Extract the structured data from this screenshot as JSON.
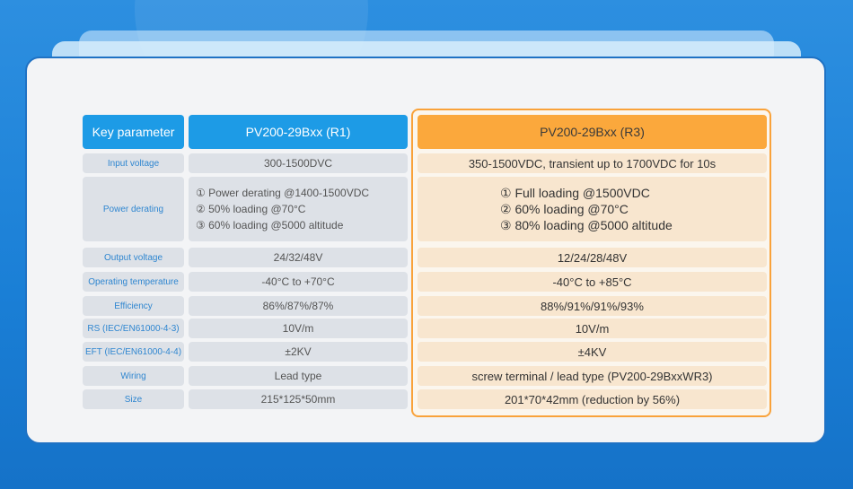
{
  "table": {
    "header": {
      "key": "Key parameter",
      "r1": "PV200-29Bxx (R1)",
      "r3": "PV200-29Bxx (R3)"
    },
    "rows": [
      {
        "label": "Input voltage",
        "r1": "300-1500DVC",
        "r3": "350-1500VDC, transient up to 1700VDC for 10s"
      },
      {
        "label": "Power derating",
        "r1_lines": [
          "① Power derating @1400-1500VDC",
          "② 50% loading @70°C",
          "③ 60% loading @5000 altitude"
        ],
        "r3_lines": [
          "① Full loading @1500VDC",
          "② 60% loading @70°C",
          "③ 80% loading @5000 altitude"
        ]
      },
      {
        "label": "Output voltage",
        "r1": "24/32/48V",
        "r3": "12/24/28/48V"
      },
      {
        "label": "Operating temperature",
        "r1": "-40°C to +70°C",
        "r3": "-40°C to +85°C"
      },
      {
        "label": "Efficiency",
        "r1": "86%/87%/87%",
        "r3": "88%/91%/91%/93%"
      },
      {
        "label": "RS (IEC/EN61000-4-3)",
        "r1": "10V/m",
        "r3": "10V/m"
      },
      {
        "label": "EFT (IEC/EN61000-4-4)",
        "r1": "±2KV",
        "r3": "±4KV"
      },
      {
        "label": "Wiring",
        "r1": "Lead type",
        "r3": "screw terminal / lead type (PV200-29BxxWR3)"
      },
      {
        "label": "Size",
        "r1": "215*125*50mm",
        "r3": "201*70*42mm (reduction by 56%)"
      }
    ]
  },
  "colors": {
    "header_blue": "#1d9be6",
    "header_orange": "#fba83c",
    "highlight_border": "#f9a23a"
  }
}
